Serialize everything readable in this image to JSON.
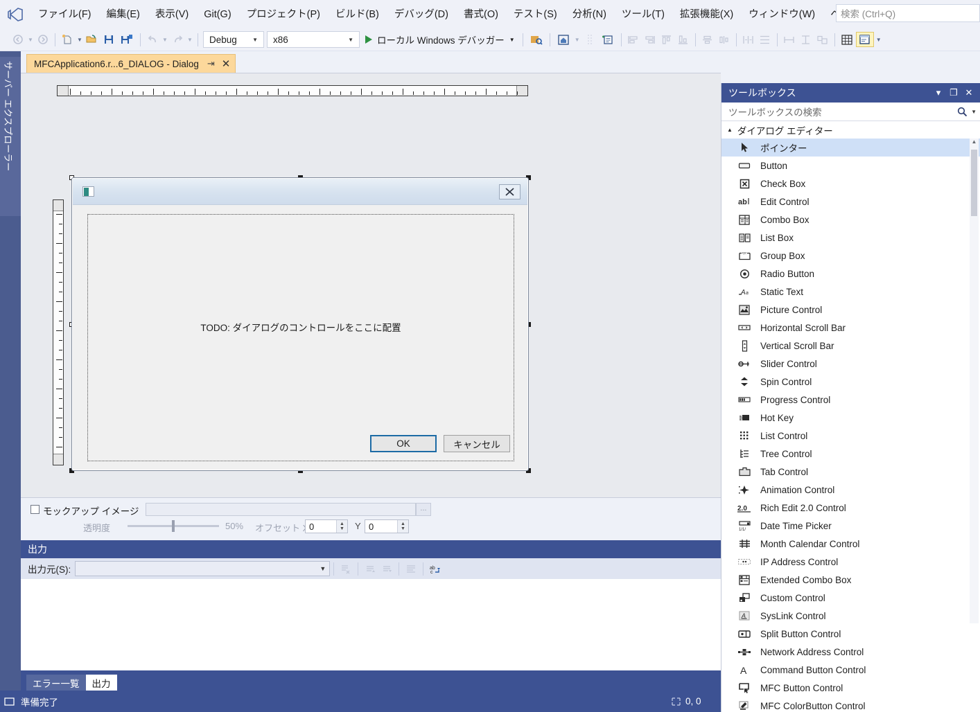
{
  "app": {
    "logo_icon": "visual-studio-logo",
    "menus": [
      "ファイル(F)",
      "編集(E)",
      "表示(V)",
      "Git(G)",
      "プロジェクト(P)",
      "ビルド(B)",
      "デバッグ(D)",
      "書式(O)",
      "テスト(S)",
      "分析(N)",
      "ツール(T)",
      "拡張機能(X)",
      "ウィンドウ(W)",
      "ヘルプ(H)"
    ],
    "quick_search_placeholder": "検索 (Ctrl+Q)"
  },
  "toolbar": {
    "config_value": "Debug",
    "platform_value": "x86",
    "run_label": "ローカル Windows デバッガー",
    "icons": [
      "navigate-back-icon",
      "navigate-forward-icon",
      "new-file-icon",
      "open-file-icon",
      "save-icon",
      "save-all-icon",
      "undo-icon",
      "redo-icon",
      "start-debug-icon",
      "test-explorer-icon",
      "home-icon",
      "new-item-icon",
      "align-lefts-icon",
      "align-rights-icon",
      "align-tops-icon",
      "align-bottoms-icon",
      "center-horizontal-icon",
      "center-vertical-icon",
      "space-across-icon",
      "space-down-icon",
      "make-same-width-icon",
      "make-same-height-icon",
      "make-same-size-icon",
      "toggle-grid-icon",
      "test-dialog-icon"
    ]
  },
  "left_dock": {
    "label": "サーバー エクスプローラー"
  },
  "document_tab": {
    "title": "MFCApplication6.r...6_DIALOG - Dialog",
    "pin_icon": "pin-icon",
    "close_icon": "close-icon"
  },
  "designer": {
    "dialog": {
      "app_icon": "app-window-icon",
      "close_icon": "close-icon",
      "todo_text": "TODO: ダイアログのコントロールをここに配置",
      "buttons": [
        {
          "label": "OK",
          "selected": true
        },
        {
          "label": "キャンセル",
          "selected": false
        }
      ]
    }
  },
  "mockup_bar": {
    "checkbox_label": "モックアップ イメージ",
    "checked": false,
    "path_value": "",
    "browse_label": "...",
    "opacity_label": "透明度",
    "opacity_value": "50%",
    "offset_label": "オフセット X",
    "offset_x": "0",
    "offset_y_label": "Y",
    "offset_y": "0"
  },
  "output_panel": {
    "title": "出力",
    "source_label": "出力元(S):",
    "source_value": "",
    "toolbar_icons": [
      "clear-all-icon",
      "go-to-previous-icon",
      "go-to-next-icon",
      "toggle-wordwrap-icon",
      "toggle-autoscroll-icon"
    ],
    "body_text": ""
  },
  "bottom_tabs": [
    {
      "label": "エラー一覧",
      "active": false
    },
    {
      "label": "出力",
      "active": true
    }
  ],
  "status_bar": {
    "text": "準備完了",
    "position_icon": "cursor-position-icon",
    "position": "0, 0"
  },
  "toolbox": {
    "title": "ツールボックス",
    "header_icons": [
      "chevron-down-icon",
      "maximize-icon",
      "close-icon"
    ],
    "search_placeholder": "ツールボックスの検索",
    "search_icon": "search-icon",
    "search_caret_icon": "chevron-down-icon",
    "category": "ダイアログ エディター",
    "category_expanded": true,
    "items": [
      {
        "label": "ポインター",
        "icon": "pointer-icon",
        "selected": true
      },
      {
        "label": "Button",
        "icon": "button-icon",
        "selected": false
      },
      {
        "label": "Check Box",
        "icon": "checkbox-icon",
        "selected": false
      },
      {
        "label": "Edit Control",
        "icon": "edit-control-icon",
        "selected": false
      },
      {
        "label": "Combo Box",
        "icon": "combobox-icon",
        "selected": false
      },
      {
        "label": "List Box",
        "icon": "listbox-icon",
        "selected": false
      },
      {
        "label": "Group Box",
        "icon": "groupbox-icon",
        "selected": false
      },
      {
        "label": "Radio Button",
        "icon": "radio-button-icon",
        "selected": false
      },
      {
        "label": "Static Text",
        "icon": "static-text-icon",
        "selected": false
      },
      {
        "label": "Picture Control",
        "icon": "picture-control-icon",
        "selected": false
      },
      {
        "label": "Horizontal Scroll Bar",
        "icon": "horizontal-scrollbar-icon",
        "selected": false
      },
      {
        "label": "Vertical Scroll Bar",
        "icon": "vertical-scrollbar-icon",
        "selected": false
      },
      {
        "label": "Slider Control",
        "icon": "slider-icon",
        "selected": false
      },
      {
        "label": "Spin Control",
        "icon": "spin-icon",
        "selected": false
      },
      {
        "label": "Progress Control",
        "icon": "progress-icon",
        "selected": false
      },
      {
        "label": "Hot Key",
        "icon": "hotkey-icon",
        "selected": false
      },
      {
        "label": "List Control",
        "icon": "list-control-icon",
        "selected": false
      },
      {
        "label": "Tree Control",
        "icon": "tree-control-icon",
        "selected": false
      },
      {
        "label": "Tab Control",
        "icon": "tab-control-icon",
        "selected": false
      },
      {
        "label": "Animation Control",
        "icon": "animation-icon",
        "selected": false
      },
      {
        "label": "Rich Edit 2.0 Control",
        "icon": "rich-edit-icon",
        "selected": false
      },
      {
        "label": "Date Time Picker",
        "icon": "date-time-picker-icon",
        "selected": false
      },
      {
        "label": "Month Calendar Control",
        "icon": "month-calendar-icon",
        "selected": false
      },
      {
        "label": "IP Address Control",
        "icon": "ip-address-icon",
        "selected": false
      },
      {
        "label": "Extended Combo Box",
        "icon": "extended-combobox-icon",
        "selected": false
      },
      {
        "label": "Custom Control",
        "icon": "custom-control-icon",
        "selected": false
      },
      {
        "label": "SysLink Control",
        "icon": "syslink-icon",
        "selected": false
      },
      {
        "label": "Split Button Control",
        "icon": "split-button-icon",
        "selected": false
      },
      {
        "label": "Network Address Control",
        "icon": "network-address-icon",
        "selected": false
      },
      {
        "label": "Command Button Control",
        "icon": "command-button-icon",
        "selected": false
      },
      {
        "label": "MFC Button Control",
        "icon": "mfc-button-icon",
        "selected": false
      },
      {
        "label": "MFC ColorButton Control",
        "icon": "mfc-colorbutton-icon",
        "selected": false
      }
    ]
  },
  "colors": {
    "accent_blue": "#3d5293",
    "tab_orange": "#fcd89b",
    "selection_blue": "#cfe0f7",
    "toolbar_bg": "#eff1f8",
    "run_green": "#2e9141",
    "ok_border": "#1d6ba5"
  }
}
